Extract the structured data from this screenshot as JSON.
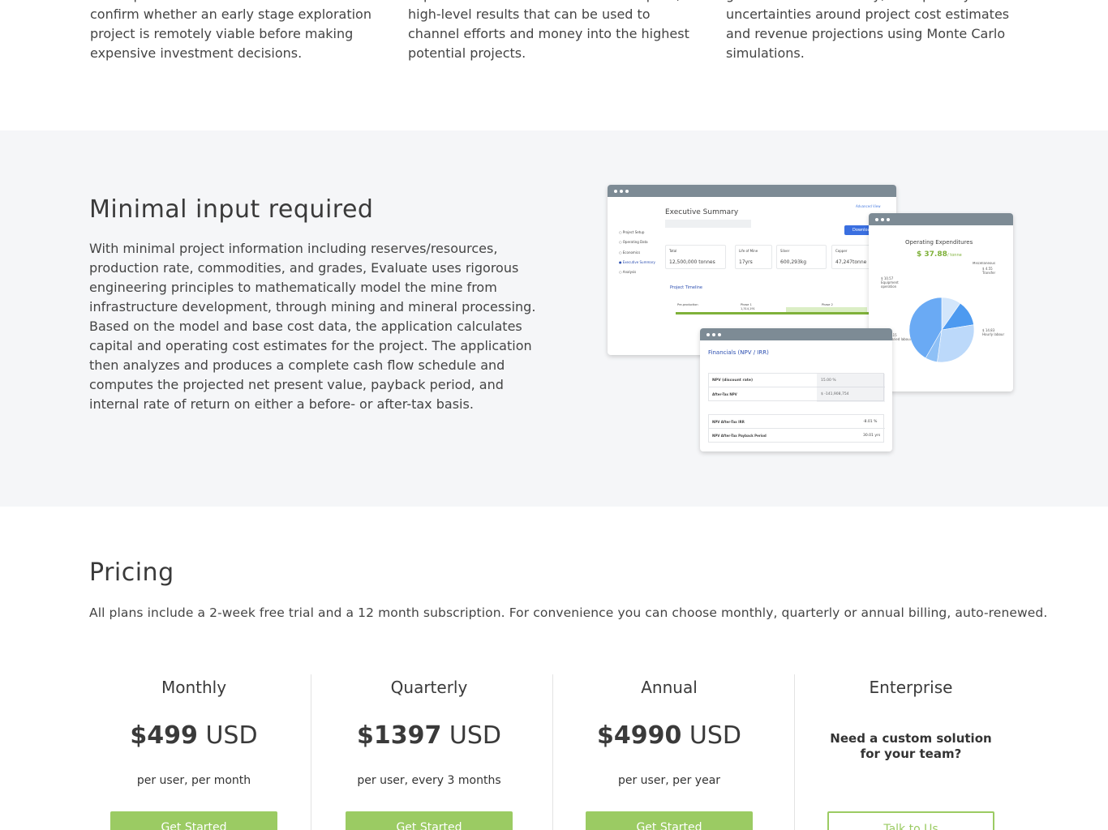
{
  "features": [
    {
      "text": "developers and investors to assess or\nconfirm whether an early stage exploration\nproject is remotely viable before making\nexpensive investment decisions."
    },
    {
      "text": "explorers and investors—it delivers quick,\nhigh-level results that can be used to\nchannel efforts and money into the highest\npotential projects."
    },
    {
      "text": "grade and mill recovery, and quantify\nuncertainties around project cost estimates\nand revenue projections using Monte Carlo\nsimulations."
    }
  ],
  "minimal": {
    "title": "Minimal input required",
    "description": "With minimal project information including reserves/resources, production rate, commodities, and grades, Evaluate uses rigorous engineering principles to mathematically model the mine from infrastructure development, through mining and mineral processing. Based on the model and base cost data, the application calculates capital and operating cost estimates for the project. The application then analyzes and produces a complete cash flow schedule and computes the projected net present value, payback period, and internal rate of return on either a before- or after-tax basis."
  },
  "mockups": {
    "exec": {
      "title": "Executive Summary",
      "nav": [
        "Project Setup",
        "Operating Data",
        "Economics",
        "Executive Summary",
        "Analysis"
      ],
      "button": "Download",
      "link": "Advanced View",
      "cards": [
        {
          "label": "Total",
          "value": "12,500,000 tonnes"
        },
        {
          "label": "Life of Mine",
          "value": "17yrs"
        },
        {
          "label": "Silver",
          "value": "600,293kg"
        },
        {
          "label": "Copper",
          "value": "47,247tonne"
        }
      ],
      "timeline_title": "Project Timeline",
      "timeline_labels": [
        "Pre-production",
        "Phase 1",
        "Phase 2"
      ],
      "timeline_values": [
        "1,314,191",
        "7,542,000"
      ]
    },
    "opex": {
      "title": "Operating Expenditures",
      "value": "$ 37.88",
      "unit": "/ tonne",
      "labels": [
        "$ 3.44\nMiscellaneous",
        "$ 4.55\nTransfer",
        "$ 10.57\nEquipment\noperation",
        "$ 2.15\nSalaried labour",
        "$ 14.83\nHourly labour"
      ]
    },
    "fin": {
      "title": "Financials (NPV / IRR)",
      "rows": [
        {
          "label": "NPV (discount rate)",
          "value": "15.00 %"
        },
        {
          "label": "After-Tax NPV",
          "value": "$ -141,908,754"
        },
        {
          "label": "NPV After-Tax IRR",
          "value": "-8.01 %"
        },
        {
          "label": "NPV After-Tax Payback Period",
          "value": "30.01 yrs"
        }
      ]
    }
  },
  "chart_data": {
    "type": "pie",
    "categories": [
      "Miscellaneous",
      "Transfer",
      "Equipment operation",
      "Salaried labour",
      "Hourly labour"
    ],
    "values": [
      3.44,
      4.55,
      10.57,
      2.15,
      14.83
    ],
    "title": "Operating Expenditures",
    "colors": [
      "#d3e6fb",
      "#4d9af0",
      "#bcd9fa",
      "#8ec0f6",
      "#6aaaf4"
    ]
  },
  "pricing": {
    "title": "Pricing",
    "subtitle": "All plans include a 2-week free trial and a 12 month subscription. For convenience you can choose monthly, quarterly or annual billing, auto-renewed.",
    "plans": [
      {
        "name": "Monthly",
        "amount": "$499",
        "currency": "USD",
        "per": "per user, per month",
        "cta": "Get Started"
      },
      {
        "name": "Quarterly",
        "amount": "$1397",
        "currency": "USD",
        "per": "per user, every 3 months",
        "cta": "Get Started"
      },
      {
        "name": "Annual",
        "amount": "$4990",
        "currency": "USD",
        "per": "per user, per year",
        "cta": "Get Started"
      },
      {
        "name": "Enterprise",
        "custom": "Need a custom solution\nfor your team?",
        "cta": "Talk to Us"
      }
    ],
    "accent": "#9bcb63"
  }
}
